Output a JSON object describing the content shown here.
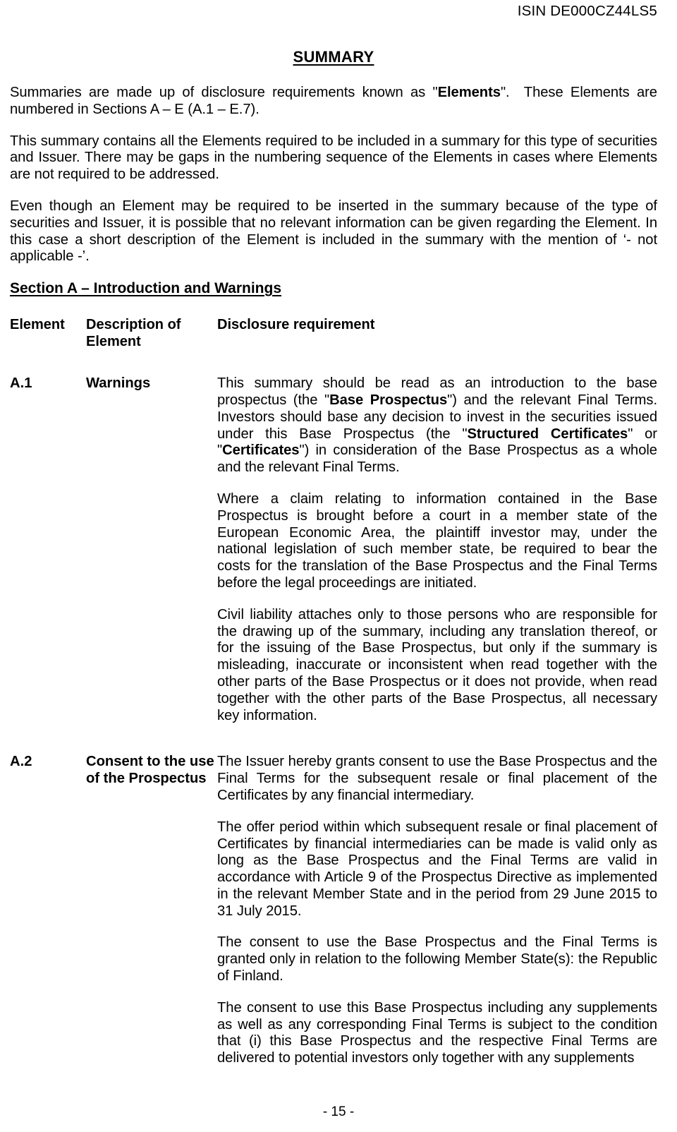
{
  "header": {
    "isin": "ISIN DE000CZ44LS5"
  },
  "title": "SUMMARY",
  "intro_paragraphs": [
    "Summaries are made up of disclosure requirements known as \"Elements\".  These Elements are numbered in Sections A – E (A.1 – E.7).",
    "This summary contains all the Elements required to be included in a summary for this type of securities and Issuer.  There may be gaps in the numbering sequence of the Elements in cases where Elements are not required to be addressed.",
    "Even though an Element may be required to be inserted in the summary because of the type of securities and Issuer, it is possible that no relevant information can be given regarding the Element.  In this case a short description of the Element is included in the summary with the mention of ‘- not applicable -’."
  ],
  "section": {
    "heading": "Section A – Introduction and Warnings",
    "columns": {
      "element": "Element",
      "description": "Description of Element",
      "disclosure": "Disclosure requirement"
    }
  },
  "rows": [
    {
      "element": "A.1",
      "description": "Warnings",
      "paragraphs": [
        "This summary should be read as an introduction to the base prospectus (the \"Base Prospectus\") and the relevant Final Terms. Investors should base any decision to invest in the securities issued under this Base Prospectus (the \"Structured Certificates\" or \"Certificates\") in consideration of the Base Prospectus as a whole and the relevant Final Terms.",
        "Where a claim relating to information contained in the Base Prospectus is brought before a court in a member state of the European Economic Area, the plaintiff investor may, under the national legislation of such member state, be required to bear the costs for the translation of the Base Prospectus and the Final Terms before the legal proceedings are initiated.",
        "Civil liability attaches only to those persons who are responsible for the drawing up of the summary, including any translation thereof, or for the issuing of the Base Prospectus, but only if the summary is misleading, inaccurate or inconsistent when read together with the other parts of the Base Prospectus or it does not provide, when read together with the other parts of the Base Prospectus, all necessary key information."
      ]
    },
    {
      "element": "A.2",
      "description": "Consent to the use of the Prospectus",
      "paragraphs": [
        "The Issuer hereby grants consent to use the Base Prospectus and the Final Terms for the subsequent resale or final placement of the Certificates by any financial intermediary.",
        "The offer period within which subsequent resale or final placement of Certificates by financial intermediaries can be made is valid only as long as the Base Prospectus and the Final Terms are valid in accordance with Article 9 of the Prospectus Directive as implemented in the relevant Member State and in the period from 29 June 2015 to 31 July 2015.",
        "The consent to use the Base Prospectus and the Final Terms is granted only in relation to the following Member State(s): the Republic of Finland.",
        "The consent to use this Base Prospectus including any supplements as well as any corresponding Final Terms is subject to the condition that (i) this Base Prospectus and the respective Final Terms are delivered to potential investors only together with any supplements"
      ]
    }
  ],
  "footer": {
    "page_number": "- 15 -"
  }
}
